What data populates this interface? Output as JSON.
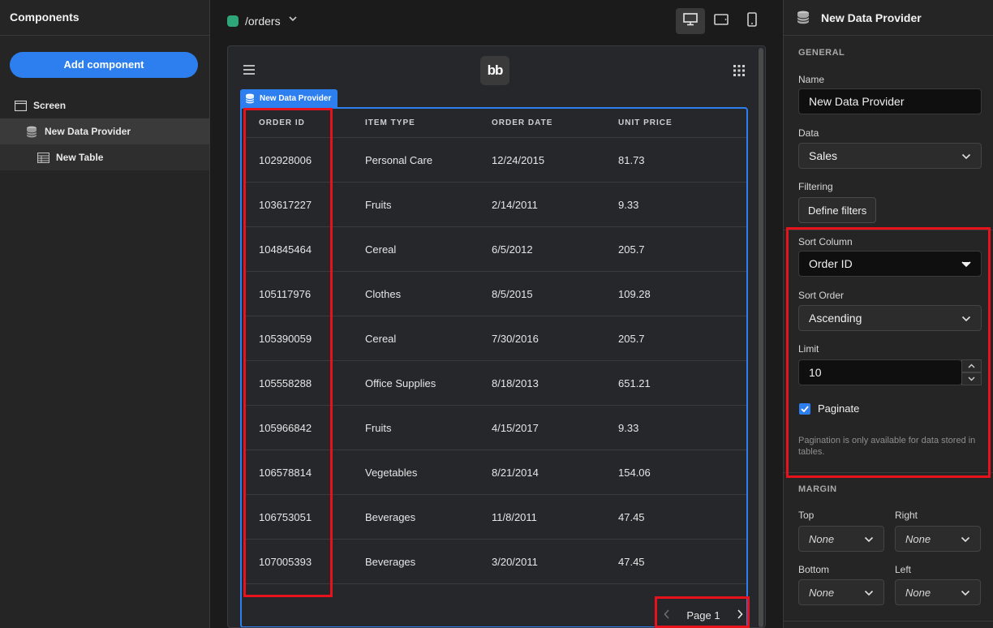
{
  "left_panel": {
    "title": "Components",
    "add_button": "Add component",
    "tree": [
      {
        "label": "Screen"
      },
      {
        "label": "New Data Provider"
      },
      {
        "label": "New Table"
      }
    ]
  },
  "topbar": {
    "route": "/orders",
    "devices": [
      "desktop",
      "tablet",
      "mobile"
    ],
    "active_device": "desktop"
  },
  "preview": {
    "logo": "bb",
    "data_provider_tag": "New Data Provider",
    "table": {
      "columns": [
        "ORDER ID",
        "ITEM TYPE",
        "ORDER DATE",
        "UNIT PRICE"
      ],
      "rows": [
        [
          "102928006",
          "Personal Care",
          "12/24/2015",
          "81.73"
        ],
        [
          "103617227",
          "Fruits",
          "2/14/2011",
          "9.33"
        ],
        [
          "104845464",
          "Cereal",
          "6/5/2012",
          "205.7"
        ],
        [
          "105117976",
          "Clothes",
          "8/5/2015",
          "109.28"
        ],
        [
          "105390059",
          "Cereal",
          "7/30/2016",
          "205.7"
        ],
        [
          "105558288",
          "Office Supplies",
          "8/18/2013",
          "651.21"
        ],
        [
          "105966842",
          "Fruits",
          "4/15/2017",
          "9.33"
        ],
        [
          "106578814",
          "Vegetables",
          "8/21/2014",
          "154.06"
        ],
        [
          "106753051",
          "Beverages",
          "11/8/2011",
          "47.45"
        ],
        [
          "107005393",
          "Beverages",
          "3/20/2011",
          "47.45"
        ]
      ]
    },
    "pager": {
      "label": "Page 1"
    }
  },
  "right_panel": {
    "title": "New Data Provider",
    "general_heading": "GENERAL",
    "name_label": "Name",
    "name_value": "New Data Provider",
    "data_label": "Data",
    "data_value": "Sales",
    "filtering_label": "Filtering",
    "filters_button": "Define filters",
    "sort_column_label": "Sort Column",
    "sort_column_value": "Order ID",
    "sort_order_label": "Sort Order",
    "sort_order_value": "Ascending",
    "limit_label": "Limit",
    "limit_value": "10",
    "paginate_label": "Paginate",
    "paginate_checked": true,
    "pagination_note": "Pagination is only available for data stored in tables.",
    "margin_heading": "MARGIN",
    "margin": {
      "top_label": "Top",
      "top_value": "None",
      "right_label": "Right",
      "right_value": "None",
      "bottom_label": "Bottom",
      "bottom_value": "None",
      "left_label": "Left",
      "left_value": "None"
    }
  },
  "colors": {
    "accent": "#2d7ff0",
    "highlight": "#e8121c",
    "route_dot": "#2fa57a"
  }
}
